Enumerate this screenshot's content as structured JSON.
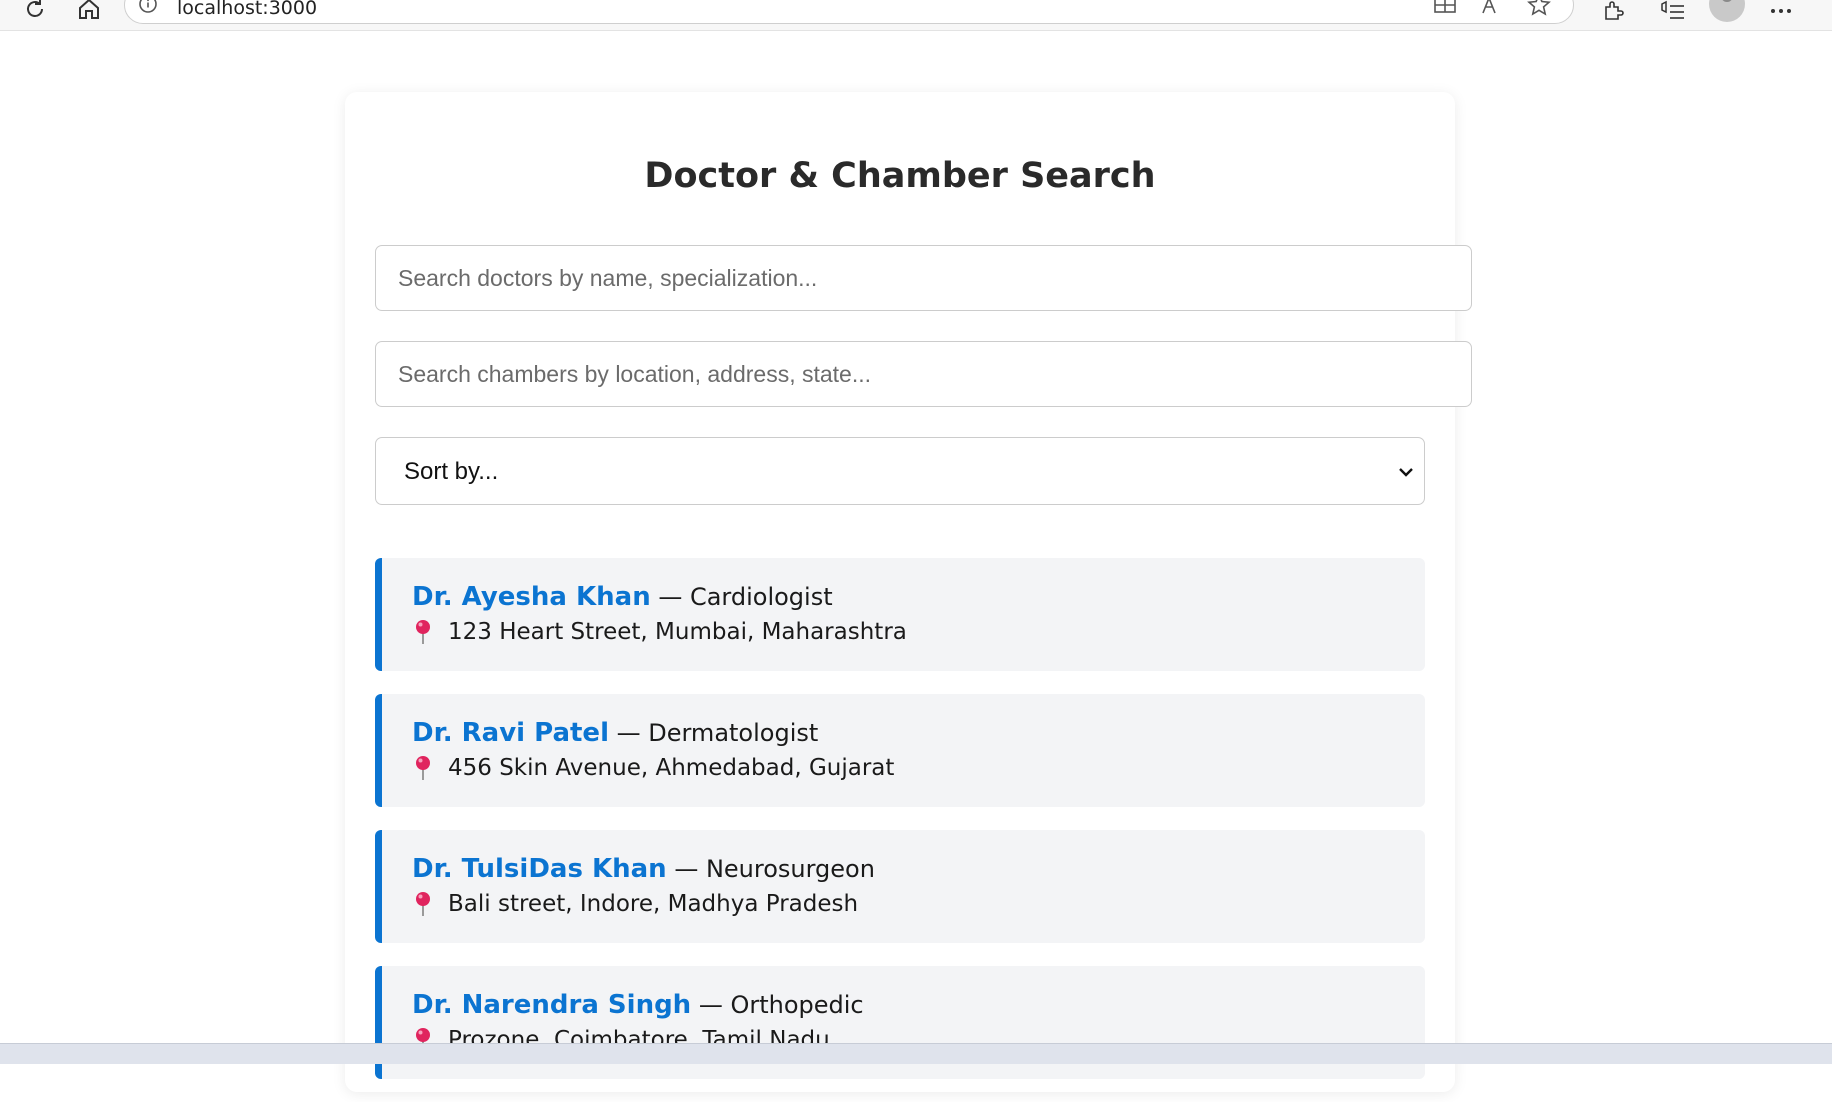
{
  "browser": {
    "url": "localhost:3000"
  },
  "page": {
    "title": "Doctor & Chamber Search",
    "doctor_search_placeholder": "Search doctors by name, specialization...",
    "chamber_search_placeholder": "Search chambers by location, address, state...",
    "sort_label": "Sort by..."
  },
  "results": [
    {
      "name": "Dr. Ayesha Khan",
      "specialty": " — Cardiologist",
      "address": "123 Heart Street, Mumbai, Maharashtra"
    },
    {
      "name": "Dr. Ravi Patel",
      "specialty": " — Dermatologist",
      "address": "456 Skin Avenue, Ahmedabad, Gujarat"
    },
    {
      "name": "Dr. TulsiDas Khan",
      "specialty": " — Neurosurgeon",
      "address": "Bali street, Indore, Madhya Pradesh"
    },
    {
      "name": "Dr. Narendra Singh",
      "specialty": " — Orthopedic",
      "address": "Prozone, Coimbatore, Tamil Nadu"
    }
  ],
  "colors": {
    "accent": "#0b74d1",
    "item_background": "#f3f4f6",
    "pin": "#e0245e"
  }
}
